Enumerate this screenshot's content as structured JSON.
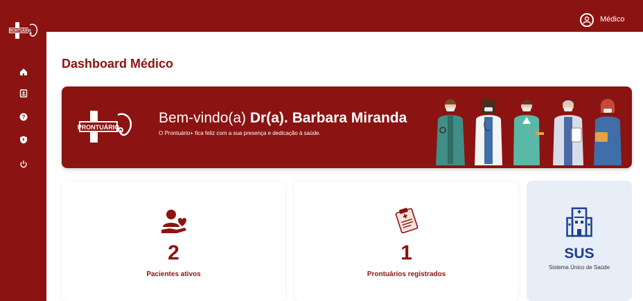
{
  "app": {
    "brand": "PRONTUÁRIO"
  },
  "topbar": {
    "user_role": "Médico"
  },
  "page": {
    "title": "Dashboard Médico"
  },
  "banner": {
    "welcome_prefix": "Bem-vindo(a) ",
    "doctor_name": "Dr(a). Barbara Miranda",
    "subtitle": "O Prontuário+ fica feliz com a sua presença e dedicação à saúde."
  },
  "cards": [
    {
      "value": "2",
      "label": "Pacientes ativos"
    },
    {
      "value": "1",
      "label": "Prontuários registrados"
    }
  ],
  "sus": {
    "title": "SUS",
    "subtitle": "Sistema Único de Saúde"
  },
  "nav": {
    "items": [
      {
        "icon": "home-icon"
      },
      {
        "icon": "patient-id-icon"
      },
      {
        "icon": "help-icon"
      },
      {
        "icon": "shield-icon"
      },
      {
        "icon": "power-icon"
      }
    ]
  },
  "colors": {
    "primary": "#8b1311",
    "sus_blue": "#1d3d91",
    "sus_bg": "#e8eef8"
  }
}
